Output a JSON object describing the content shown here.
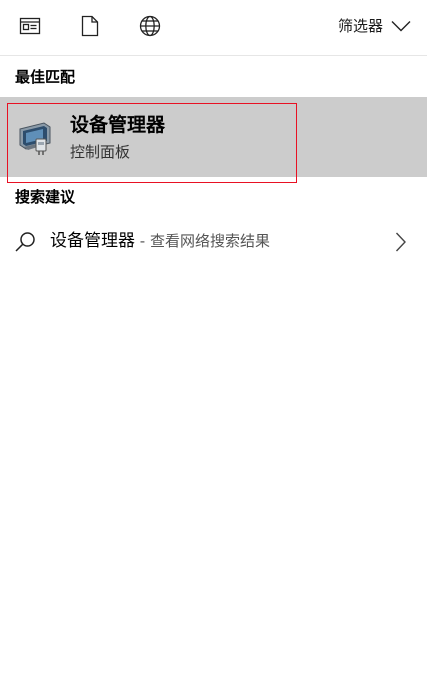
{
  "top_bar": {
    "icons": [
      "document-list-icon",
      "document-icon",
      "globe-icon"
    ],
    "filter_label": "筛选器"
  },
  "best_match": {
    "header": "最佳匹配",
    "title": "设备管理器",
    "subtitle": "控制面板",
    "icon": "device-manager-icon"
  },
  "suggestions": {
    "header": "搜索建议",
    "items": [
      {
        "text": "设备管理器",
        "separator": " - ",
        "subtext": "查看网络搜索结果",
        "icon": "search-icon"
      }
    ]
  },
  "colors": {
    "selection_bg": "#cccccc",
    "focus_outline": "#e81123"
  }
}
